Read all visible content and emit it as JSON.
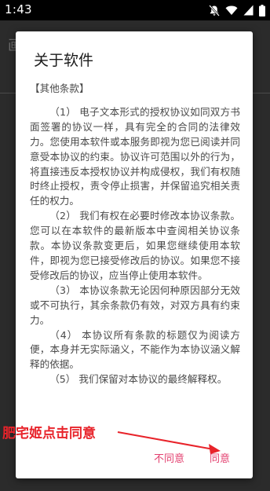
{
  "status_bar": {
    "time": "1:43",
    "icons": [
      "notifications-off-icon",
      "wifi-icon",
      "signal-icon",
      "battery-icon"
    ]
  },
  "background_app": {
    "title_fragment": "画"
  },
  "dialog": {
    "title": "关于软件",
    "section_heading": "【其他条款】",
    "paragraphs": [
      "（1） 电子文本形式的授权协议如同双方书面签署的协议一样，具有完全的合同的法律效力。您使用本软件或本服务即视为您已阅读并同意受本协议的约束。协议许可范围以外的行为，将直接违反本授权协议并构成侵权，我们有权随时终止授权，责令停止损害，并保留追究相关责任的权力。",
      "（2） 我们有权在必要时修改本协议条款。您可以在本软件的最新版本中查阅相关协议条款。本协议条款变更后，如果您继续使用本软件，即视为您已接受修改后的协议。如果您不接受修改后的协议，应当停止使用本软件。",
      "（3） 本协议条款无论因何种原因部分无效或不可执行，其余条款仍有效，对双方具有约束力。",
      "（4） 本协议所有条款的标题仅为阅读方便，本身并无实际涵义，不能作为本协议涵义解释的依据。",
      "（5） 我们保留对本协议的最终解释权。"
    ],
    "buttons": {
      "disagree": "不同意",
      "agree": "同意"
    }
  },
  "annotation": {
    "caption": "肥宅姬点击同意",
    "color": "#e8232a"
  },
  "colors": {
    "accent": "#e3406f",
    "dialog_bg": "#ffffff",
    "scrim": "#2b2b2b"
  }
}
